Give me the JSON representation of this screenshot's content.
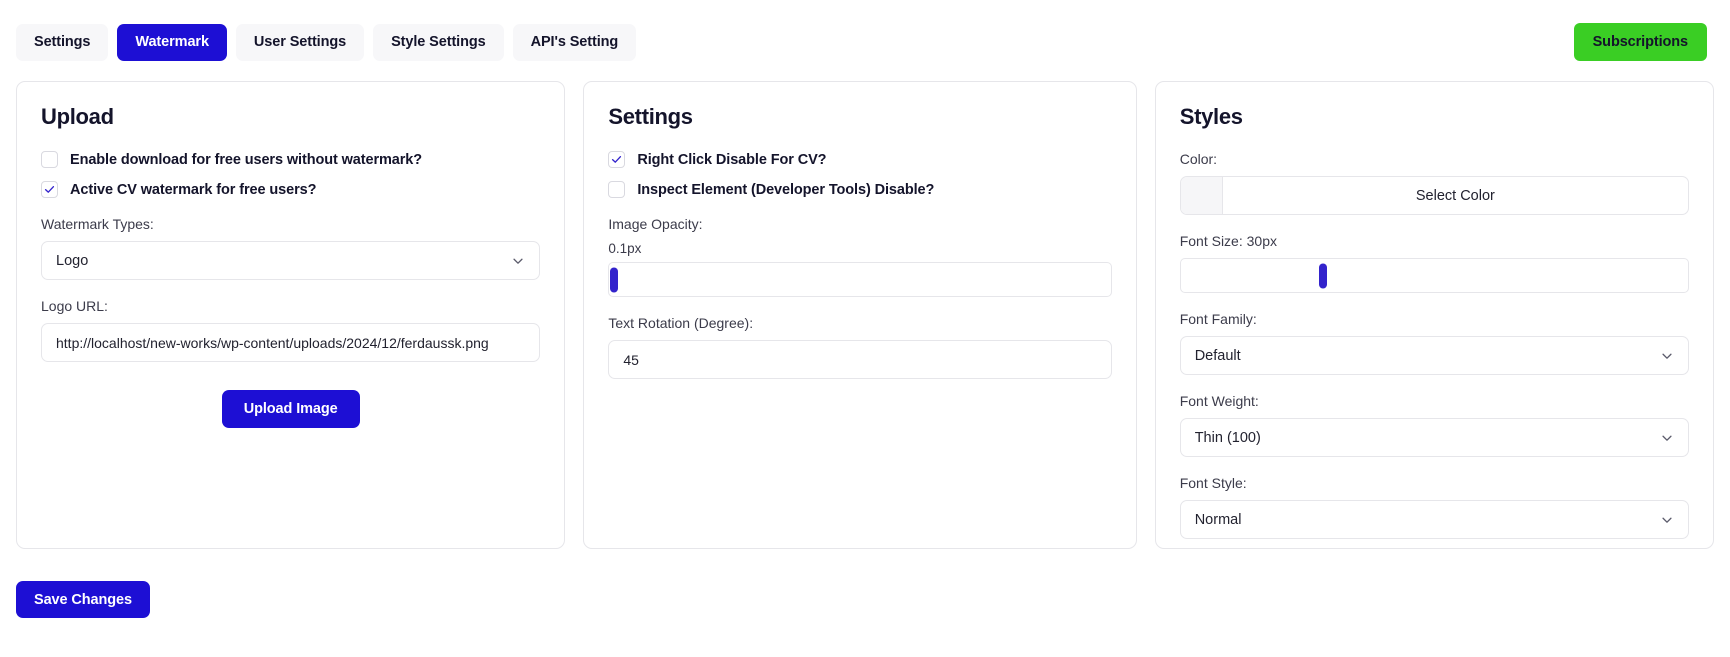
{
  "header": {
    "tabs": [
      {
        "label": "Settings",
        "active": false
      },
      {
        "label": "Watermark",
        "active": true
      },
      {
        "label": "User Settings",
        "active": false
      },
      {
        "label": "Style Settings",
        "active": false
      },
      {
        "label": "API's Setting",
        "active": false
      }
    ],
    "subscriptions_label": "Subscriptions",
    "active_tab_color": "#1d0fd4",
    "subscriptions_color": "#3ace24"
  },
  "upload": {
    "title": "Upload",
    "checkbox_free_download": {
      "label": "Enable download for free users without watermark?",
      "checked": false
    },
    "checkbox_active_cv_watermark": {
      "label": "Active CV watermark for free users?",
      "checked": true
    },
    "watermark_types_label": "Watermark Types:",
    "watermark_types_value": "Logo",
    "logo_url_label": "Logo URL:",
    "logo_url_value": "http://localhost/new-works/wp-content/uploads/2024/12/ferdaussk.png",
    "upload_button_label": "Upload Image"
  },
  "settings": {
    "title": "Settings",
    "checkbox_right_click_disable": {
      "label": "Right Click Disable For CV?",
      "checked": true
    },
    "checkbox_inspect_element_disable": {
      "label": "Inspect Element (Developer Tools) Disable?",
      "checked": false
    },
    "image_opacity_label": "Image Opacity:",
    "image_opacity_value": "0.1px",
    "image_opacity_percent": 1,
    "text_rotation_label": "Text Rotation (Degree):",
    "text_rotation_value": "45"
  },
  "styles": {
    "title": "Styles",
    "color_label": "Color:",
    "select_color_label": "Select Color",
    "color_swatch_value": "#f6f6f8",
    "font_size_label": "Font Size: 30px",
    "font_size_percent": 28,
    "font_family_label": "Font Family:",
    "font_family_value": "Default",
    "font_weight_label": "Font Weight:",
    "font_weight_value": "Thin (100)",
    "font_style_label": "Font Style:",
    "font_style_value": "Normal"
  },
  "footer": {
    "save_label": "Save Changes"
  }
}
